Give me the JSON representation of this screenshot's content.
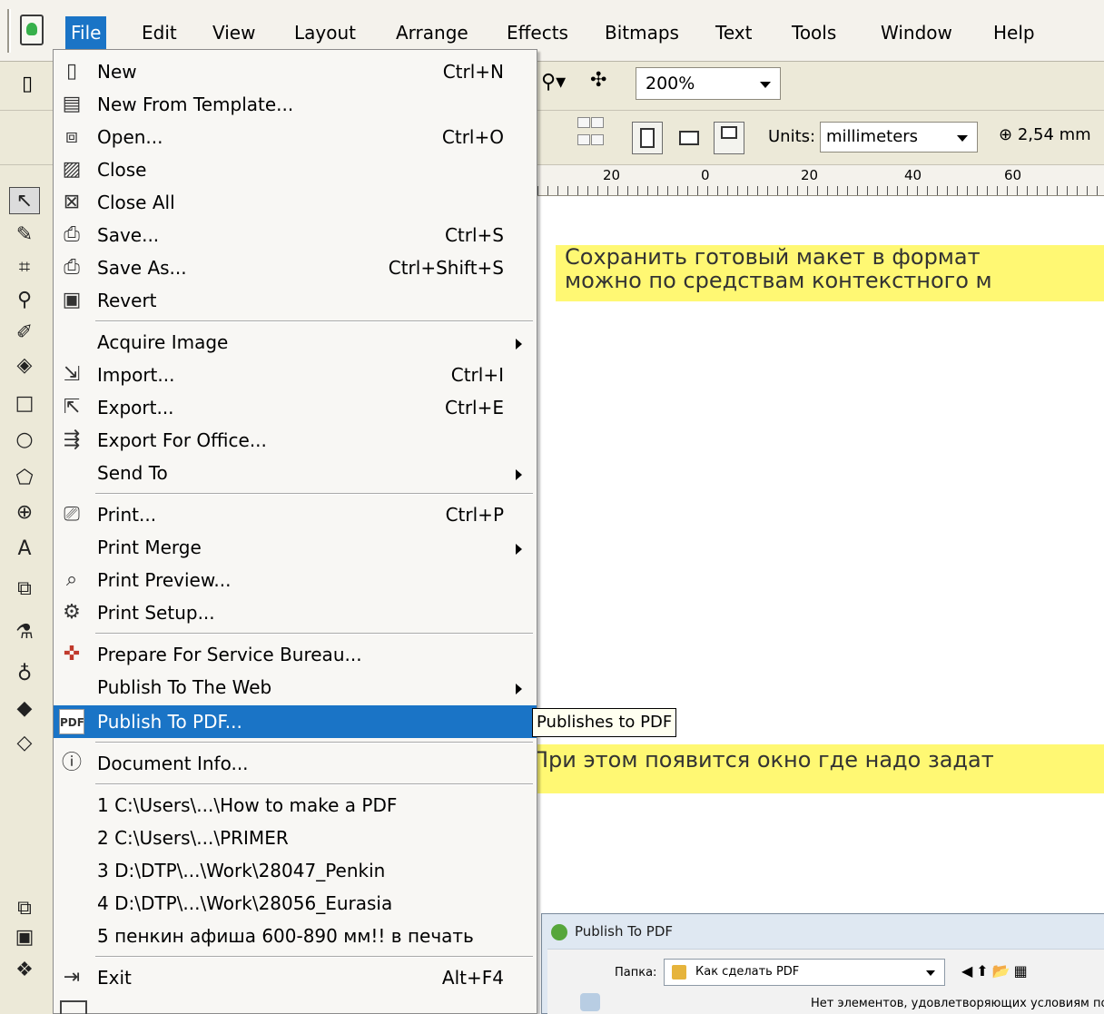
{
  "menubar": {
    "items": [
      "File",
      "Edit",
      "View",
      "Layout",
      "Arrange",
      "Effects",
      "Bitmaps",
      "Text",
      "Tools",
      "Window",
      "Help"
    ],
    "active": "File"
  },
  "toolbar": {
    "zoom": "200%",
    "units_label": "Units:",
    "units_value": "millimeters",
    "nudge": "2,54 mm"
  },
  "ruler": {
    "labels": [
      "20",
      "0",
      "20",
      "40",
      "60"
    ]
  },
  "file_menu": {
    "items": [
      {
        "label": "New",
        "shortcut": "Ctrl+N"
      },
      {
        "label": "New From Template...",
        "shortcut": ""
      },
      {
        "label": "Open...",
        "shortcut": "Ctrl+O"
      },
      {
        "label": "Close",
        "shortcut": ""
      },
      {
        "label": "Close All",
        "shortcut": ""
      },
      {
        "label": "Save...",
        "shortcut": "Ctrl+S"
      },
      {
        "label": "Save As...",
        "shortcut": "Ctrl+Shift+S"
      },
      {
        "label": "Revert",
        "shortcut": ""
      },
      {
        "label": "Acquire Image",
        "shortcut": ""
      },
      {
        "label": "Import...",
        "shortcut": "Ctrl+I"
      },
      {
        "label": "Export...",
        "shortcut": "Ctrl+E"
      },
      {
        "label": "Export For Office...",
        "shortcut": ""
      },
      {
        "label": "Send To",
        "shortcut": ""
      },
      {
        "label": "Print...",
        "shortcut": "Ctrl+P"
      },
      {
        "label": "Print Merge",
        "shortcut": ""
      },
      {
        "label": "Print Preview...",
        "shortcut": ""
      },
      {
        "label": "Print Setup...",
        "shortcut": ""
      },
      {
        "label": "Prepare For Service Bureau...",
        "shortcut": ""
      },
      {
        "label": "Publish To The Web",
        "shortcut": ""
      },
      {
        "label": "Publish To PDF...",
        "shortcut": ""
      },
      {
        "label": "Document Info...",
        "shortcut": ""
      },
      {
        "label": "1 C:\\Users\\...\\How to make a PDF",
        "shortcut": ""
      },
      {
        "label": "2 C:\\Users\\...\\PRIMER",
        "shortcut": ""
      },
      {
        "label": "3 D:\\DTP\\...\\Work\\28047_Penkin",
        "shortcut": ""
      },
      {
        "label": "4 D:\\DTP\\...\\Work\\28056_Eurasia",
        "shortcut": ""
      },
      {
        "label": "5 пенкин афиша 600-890 мм!! в печать",
        "shortcut": ""
      },
      {
        "label": "Exit",
        "shortcut": "Alt+F4"
      }
    ],
    "highlighted": "Publish To PDF..."
  },
  "tooltip": "Publishes to PDF",
  "notes": {
    "line1": "Сохранить готовый макет в формат",
    "line2": "можно по средствам контекстного м",
    "line3": "При этом появится окно где надо задат"
  },
  "dialog": {
    "title": "Publish To PDF",
    "folder_label": "Папка:",
    "folder_value": "Как сделать PDF",
    "empty_message": "Нет элементов, удовлетворяющих условиям по"
  },
  "colors": {
    "menu_highlight": "#1a74c6",
    "note_highlight": "#fff873"
  }
}
